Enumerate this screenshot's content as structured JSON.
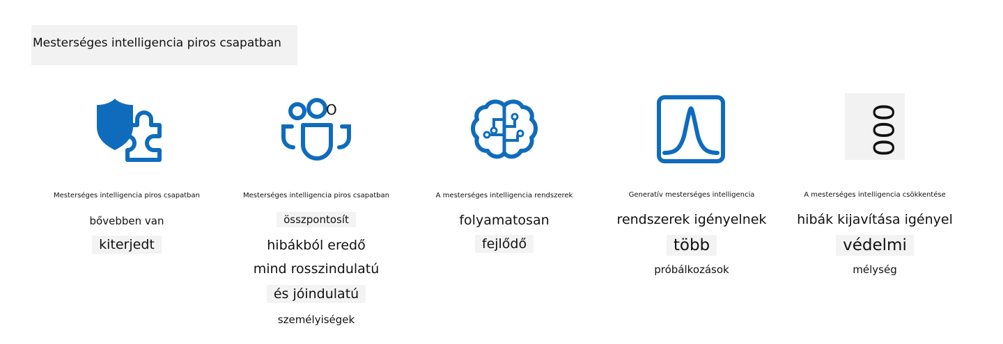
{
  "title": "Mesterséges intelligencia piros csapatban",
  "columns": [
    {
      "icon": "shield-puzzle-icon",
      "lines": [
        "Mesterséges intelligencia piros csapatban",
        "bővebben van",
        "kiterjedt"
      ]
    },
    {
      "icon": "people-team-icon",
      "icon_extra": "O",
      "lines": [
        "Mesterséges intelligencia piros csapatban",
        "összpontosít",
        "hibákból eredő",
        "mind rosszindulatú",
        "és jóindulatú",
        "személyiségek"
      ]
    },
    {
      "icon": "brain-circuit-icon",
      "lines": [
        "A mesterséges intelligencia rendszerek",
        "folyamatosan",
        "fejlődő"
      ]
    },
    {
      "icon": "bell-curve-icon",
      "lines": [
        "Generatív mesterséges intelligencia",
        "rendszerek igényelnek",
        "több",
        "próbálkozások"
      ]
    },
    {
      "icon": "stacked-circles-icon",
      "icon_text": "000",
      "lines": [
        "A mesterséges intelligencia csökkentése",
        "hibák kijavítása igényel",
        "védelmi",
        "mélység"
      ]
    }
  ],
  "colors": {
    "accent": "#0F6CBD",
    "text": "#111111",
    "label_bg": "#F3F3F3"
  }
}
